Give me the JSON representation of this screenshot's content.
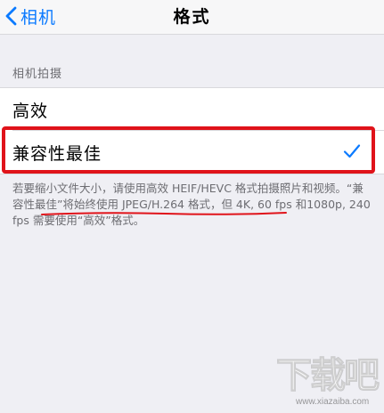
{
  "nav": {
    "back_label": "相机",
    "title": "格式"
  },
  "section": {
    "header": "相机拍摄"
  },
  "options": [
    {
      "label": "高效",
      "selected": false
    },
    {
      "label": "兼容性最佳",
      "selected": true
    }
  ],
  "footer_note": "若要缩小文件大小，请使用高效 HEIF/HEVC 格式拍摄照片和视频。“兼容性最佳”将始终使用 JPEG/H.264 格式，但 4K, 60 fps 和1080p, 240 fps 需要使用“高效”格式。",
  "watermark": {
    "text": "下载吧",
    "url": "www.xiazaiba.com"
  },
  "colors": {
    "accent": "#0a7aff",
    "highlight": "#e0131a"
  }
}
